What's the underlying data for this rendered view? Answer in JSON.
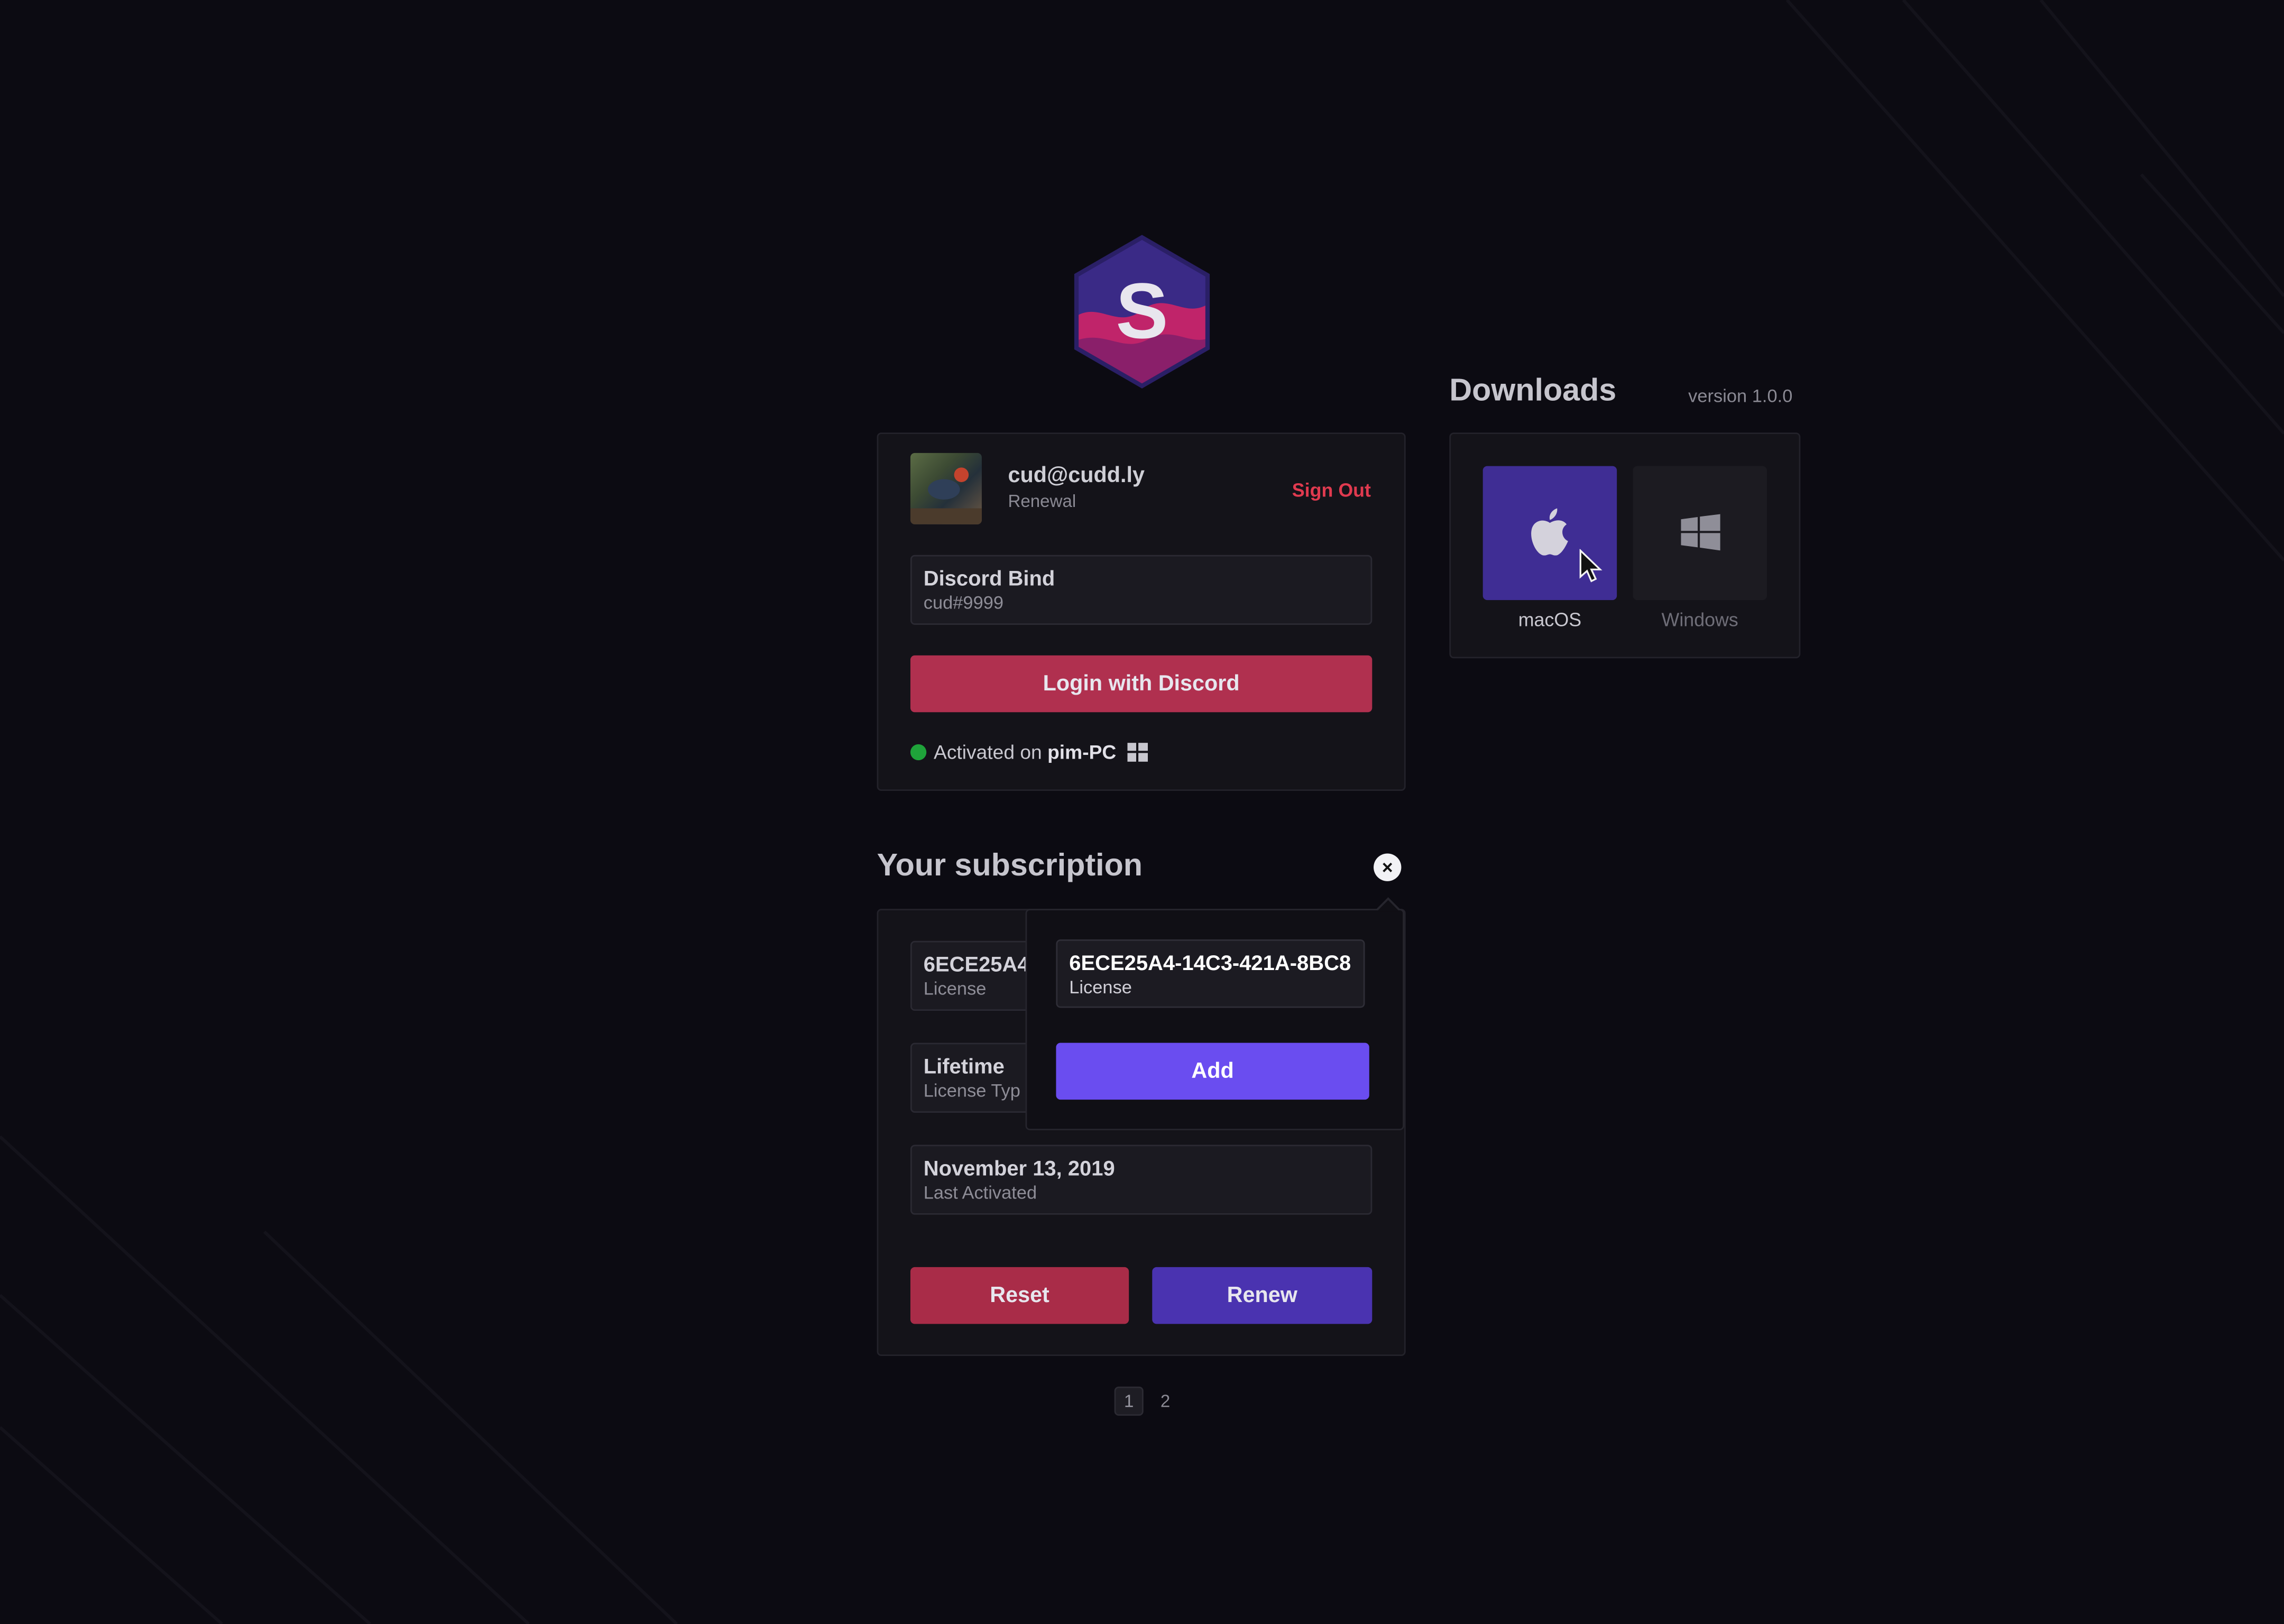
{
  "app": {
    "logo_letter": "S"
  },
  "account": {
    "email": "cud@cudd.ly",
    "plan": "Renewal",
    "sign_out_label": "Sign Out"
  },
  "discord": {
    "bind_title": "Discord Bind",
    "bind_value": "cud#9999",
    "login_label": "Login with Discord"
  },
  "status": {
    "prefix": "Activated on",
    "machine": "pim-PC",
    "dot_color": "#1fa33a",
    "os_icon": "windows-icon"
  },
  "subscription": {
    "title": "Your subscription",
    "license_value": "6ECE25A4",
    "license_label": "License",
    "type_value": "Lifetime",
    "type_label": "License Typ",
    "date_value": "November 13, 2019",
    "date_label": "Last Activated",
    "reset_label": "Reset",
    "renew_label": "Renew",
    "close_label": "×"
  },
  "popover": {
    "license_value": "6ECE25A4-14C3-421A-8BC8",
    "license_label": "License",
    "add_label": "Add"
  },
  "pagination": {
    "pages": [
      "1",
      "2"
    ],
    "current": "1"
  },
  "downloads": {
    "title": "Downloads",
    "version": "version 1.0.0",
    "platforms": [
      {
        "label": "macOS",
        "icon": "apple-icon",
        "selected": true
      },
      {
        "label": "Windows",
        "icon": "windows-icon",
        "selected": false
      }
    ]
  },
  "colors": {
    "background": "#0c0b12",
    "danger": "#b0304f",
    "accent": "#4a33b0",
    "add_button": "#6a4df0",
    "sign_out": "#e03a4f"
  }
}
